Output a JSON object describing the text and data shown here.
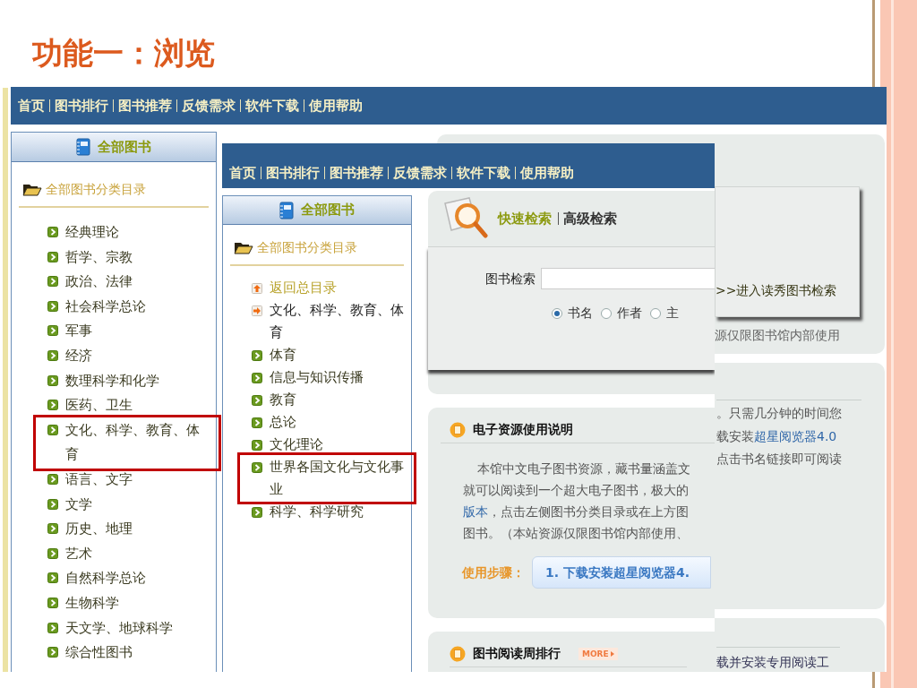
{
  "slide": {
    "title": "功能一：浏览"
  },
  "back_screen": {
    "nav": [
      "首页",
      "图书排行",
      "图书推荐",
      "反馈需求",
      "软件下载",
      "使用帮助"
    ],
    "panel_title": "全部图书",
    "catalog_title": "全部图书分类目录",
    "categories": [
      {
        "label": "经典理论",
        "highlighted": false
      },
      {
        "label": "哲学、宗教",
        "highlighted": false
      },
      {
        "label": "政治、法律",
        "highlighted": false
      },
      {
        "label": "社会科学总论",
        "highlighted": false
      },
      {
        "label": "军事",
        "highlighted": false
      },
      {
        "label": "经济",
        "highlighted": false
      },
      {
        "label": "数理科学和化学",
        "highlighted": false
      },
      {
        "label": "医药、卫生",
        "highlighted": false
      },
      {
        "label": "文化、科学、教育、体育",
        "highlighted": true
      },
      {
        "label": "语言、文字",
        "highlighted": false
      },
      {
        "label": "文学",
        "highlighted": false
      },
      {
        "label": "历史、地理",
        "highlighted": false
      },
      {
        "label": "艺术",
        "highlighted": false
      },
      {
        "label": "自然科学总论",
        "highlighted": false
      },
      {
        "label": "生物科学",
        "highlighted": false
      },
      {
        "label": "天文学、地球科学",
        "highlighted": false
      },
      {
        "label": "综合性图书",
        "highlighted": false
      }
    ],
    "search_link": ">>进入读秀图书检索",
    "notice_fragment": "源仅限图书馆内部使用",
    "intro_fragments": [
      {
        "text": "。只需几分钟的时间您"
      },
      {
        "text": "载安装",
        "link": "超星阅览器4.0"
      },
      {
        "text": "点击书名链接即可阅读"
      }
    ],
    "ranking_fragment": "载并安装专用阅读工"
  },
  "front_screen": {
    "nav": [
      "首页",
      "图书排行",
      "图书推荐",
      "反馈需求",
      "软件下载",
      "使用帮助"
    ],
    "panel_title": "全部图书",
    "catalog_title": "全部图书分类目录",
    "categories": [
      {
        "label": "返回总目录",
        "kind": "back",
        "highlighted": false
      },
      {
        "label": "文化、科学、教育、体育",
        "kind": "current",
        "highlighted": false
      },
      {
        "label": "体育",
        "kind": "sub",
        "highlighted": false
      },
      {
        "label": "信息与知识传播",
        "kind": "sub",
        "highlighted": false
      },
      {
        "label": "教育",
        "kind": "sub",
        "highlighted": false
      },
      {
        "label": "总论",
        "kind": "sub",
        "highlighted": false
      },
      {
        "label": "文化理论",
        "kind": "sub",
        "highlighted": false
      },
      {
        "label": "世界各国文化与文化事业",
        "kind": "sub",
        "highlighted": true
      },
      {
        "label": "科学、科学研究",
        "kind": "sub",
        "highlighted": false
      }
    ],
    "search": {
      "tabs": [
        {
          "label": "快速检索",
          "selected": true
        },
        {
          "label": "高级检索",
          "selected": false
        }
      ],
      "field_label": "图书检索",
      "options": [
        {
          "label": "书名",
          "selected": true
        },
        {
          "label": "作者",
          "selected": false
        },
        {
          "label": "主",
          "selected": false
        }
      ]
    },
    "notice": {
      "title": "电子资源使用说明",
      "lines": [
        {
          "text": "本馆中文电子图书资源，藏书量涵盖文"
        },
        {
          "text": "就可以阅读到一个超大电子图书，极大的"
        },
        {
          "link": "版本",
          "text": "，点击左侧图书分类目录或在上方图"
        },
        {
          "text": "图书。（本站资源仅限图书馆内部使用、"
        }
      ],
      "steps_label": "使用步骤：",
      "step_button": "1. 下载安装超星阅览器4."
    },
    "ranking": {
      "title": "图书阅读周排行",
      "more": "MORE"
    }
  }
}
